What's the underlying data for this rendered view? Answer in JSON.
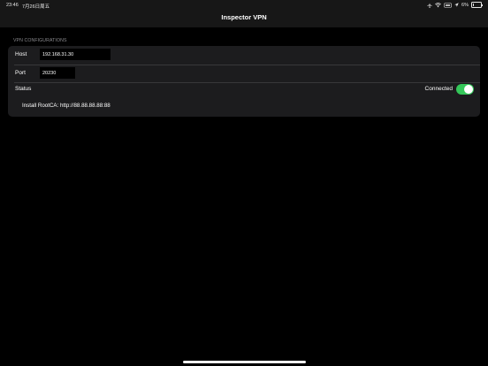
{
  "status_bar": {
    "time": "23:46",
    "date": "7月26日周五",
    "battery_percent": "6%"
  },
  "nav": {
    "title": "Inspector VPN"
  },
  "vpn": {
    "section_header": "VPN CONFIGURATIONS",
    "host_label": "Host",
    "host_value": "192.168.31.30",
    "port_label": "Port",
    "port_value": "20230",
    "status_label": "Status",
    "status_value": "Connected",
    "toggle_on": true,
    "install_text": "Install RootCA: http://88.88.88.88:88"
  },
  "colors": {
    "background": "#000000",
    "nav_background": "#171717",
    "group_background": "#1c1c1e",
    "toggle_on": "#34c759",
    "section_header": "#8a8a8e"
  }
}
